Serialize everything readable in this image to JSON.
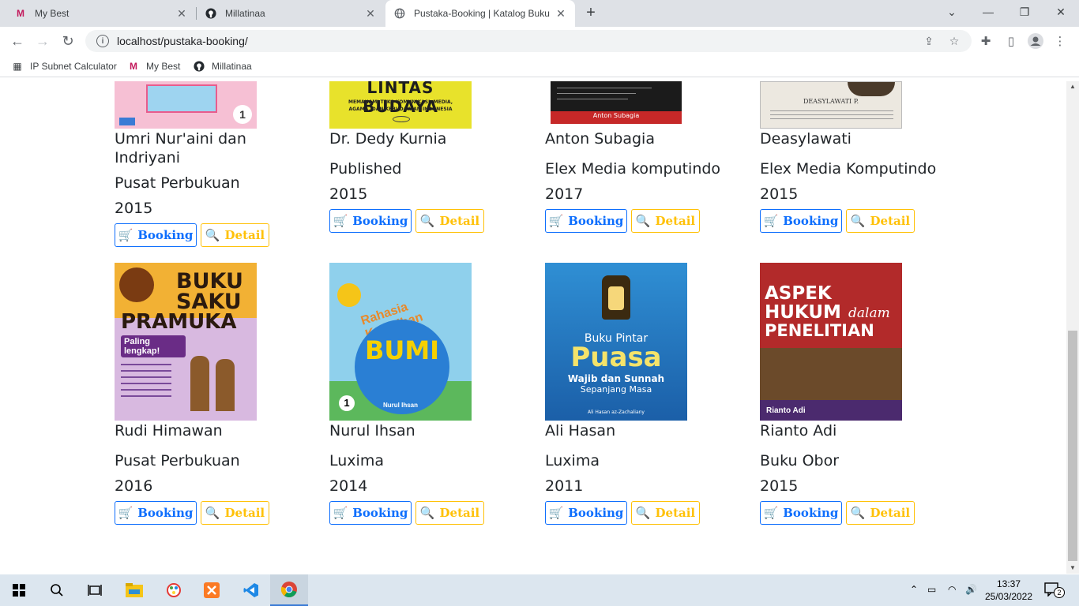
{
  "browser": {
    "tabs": [
      {
        "title": "My Best",
        "favicon": "M"
      },
      {
        "title": "Millatinaa",
        "favicon": "github-icon"
      },
      {
        "title": "Pustaka-Booking | Katalog Buku",
        "favicon": "globe-icon"
      }
    ],
    "url": "localhost/pustaka-booking/",
    "bookmarks": [
      {
        "label": "IP Subnet Calculator"
      },
      {
        "label": "My Best"
      },
      {
        "label": "Millatinaa"
      }
    ]
  },
  "buttons": {
    "booking": "Booking",
    "detail": "Detail"
  },
  "books_row1": [
    {
      "author": "Umri Nur'aini dan",
      "author2": "Indriyani",
      "publisher": "Pusat Perbukuan",
      "year": "2015",
      "cover_text": "",
      "cover_color": "#f4a9c5"
    },
    {
      "author": "Dr. Dedy Kurnia",
      "publisher": "Published",
      "year": "2015",
      "cover_text": "LINTAS BUDAYA",
      "cover_sub": "MEMAHAMI TEKS KOMUNIKASI, MEDIA, AGAMA, DAN KEBUDAYAAN INDONESIA",
      "cover_color": "#e6e02a"
    },
    {
      "author": "Anton Subagia",
      "publisher": "Elex Media komputindo",
      "year": "2017",
      "cover_text": "Anton Subagia",
      "cover_color": "#1a1a1a"
    },
    {
      "author": "Deasylawati",
      "publisher": "Elex Media Komputindo",
      "year": "2015",
      "cover_text": "DEASYLAWATI P.",
      "cover_color": "#e8e4dc"
    }
  ],
  "books_row2": [
    {
      "author": "Rudi Himawan",
      "publisher": "Pusat Perbukuan",
      "year": "2016",
      "cover_line1": "BUKU",
      "cover_line2": "SAKU",
      "cover_line3": "PRAMUKA",
      "cover_badge": "Paling lengkap!",
      "cover_color": "#f2b134"
    },
    {
      "author": "Nurul Ihsan",
      "publisher": "Luxima",
      "year": "2014",
      "cover_line1": "Rahasia Keajaiban",
      "cover_line2": "BUMI",
      "cover_small": "Nurul Ihsan",
      "cover_color": "#7cc6e8"
    },
    {
      "author": "Ali Hasan",
      "publisher": "Luxima",
      "year": "2011",
      "cover_line1": "Buku Pintar",
      "cover_line2": "Puasa",
      "cover_line3": "Wajib dan Sunnah",
      "cover_line4": "Sepanjang Masa",
      "cover_small": "Ali Hasan az-Zachaliany",
      "cover_color": "#1f6fb8"
    },
    {
      "author": "Rianto Adi",
      "publisher": "Buku Obor",
      "year": "2015",
      "cover_line1": "ASPEK",
      "cover_line2": "HUKUM",
      "cover_word": "dalam",
      "cover_line3": "PENELITIAN",
      "cover_small": "Rianto Adi",
      "cover_color": "#b8242a"
    }
  ],
  "taskbar": {
    "time": "13:37",
    "date": "25/03/2022",
    "notifications": "2"
  }
}
